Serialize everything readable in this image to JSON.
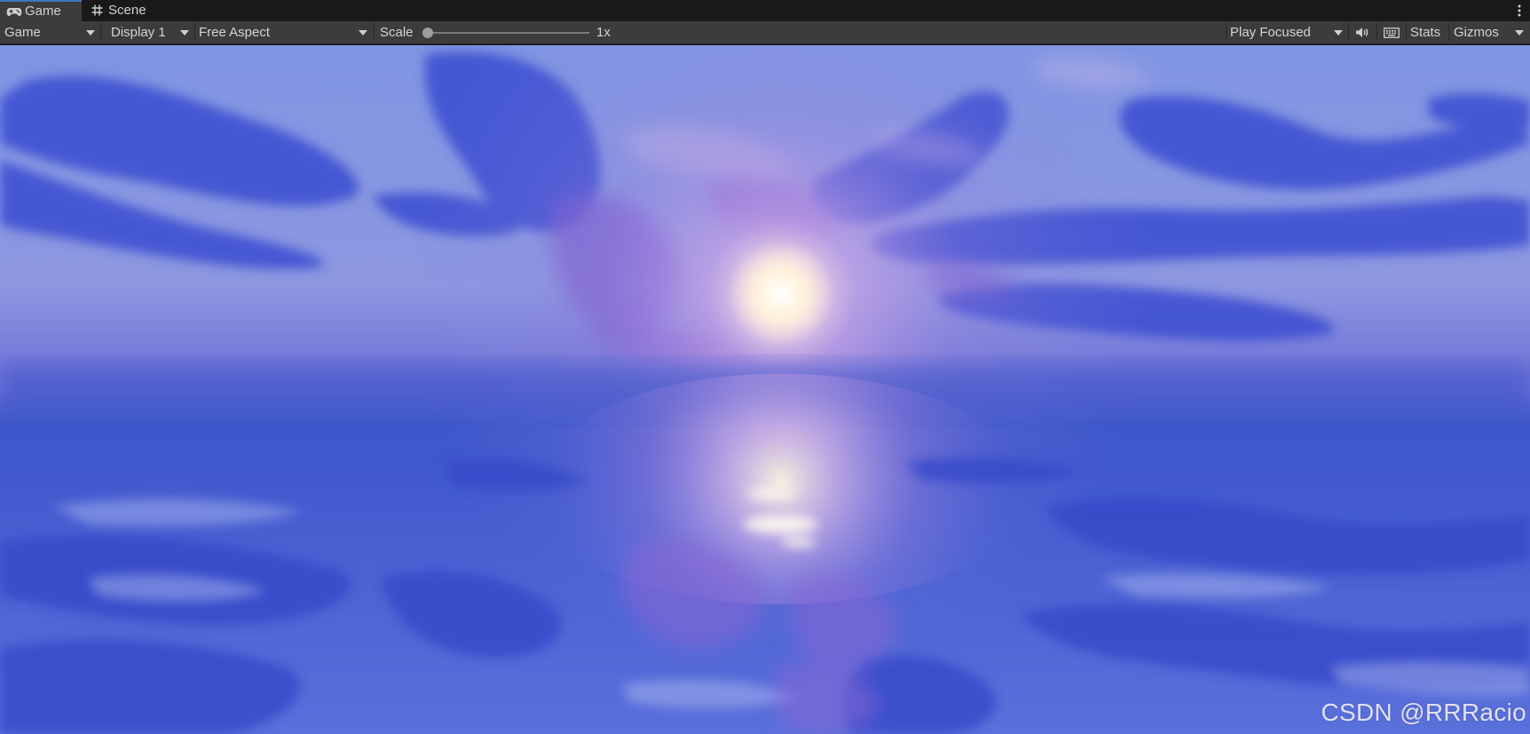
{
  "tabs": [
    {
      "label": "Game",
      "icon": "gamepad-icon",
      "active": true
    },
    {
      "label": "Scene",
      "icon": "grid-hash-icon",
      "active": false
    }
  ],
  "toolbar": {
    "view_dropdown": "Game",
    "display_dropdown": "Display 1",
    "aspect_dropdown": "Free Aspect",
    "scale_label": "Scale",
    "scale_value": "1x",
    "scale_fraction": 0,
    "play_mode_dropdown": "Play Focused",
    "mute_icon": "speaker-icon",
    "shortcuts_icon": "keyboard-icon",
    "stats_label": "Stats",
    "gizmos_label": "Gizmos"
  },
  "viewport": {
    "watermark": "CSDN @RRRacio"
  },
  "colors": {
    "tab_bar": "#191919",
    "toolbar": "#3c3c3c",
    "active_tab_accent": "#3a79bb",
    "sky_top": "#6f86dd",
    "sky_horizon": "#3b52c9",
    "sun": "#fff6e0",
    "cloud_blue": "#3a4cd0",
    "cloud_purple": "#7a5ccf",
    "water": "#4d63d6"
  }
}
